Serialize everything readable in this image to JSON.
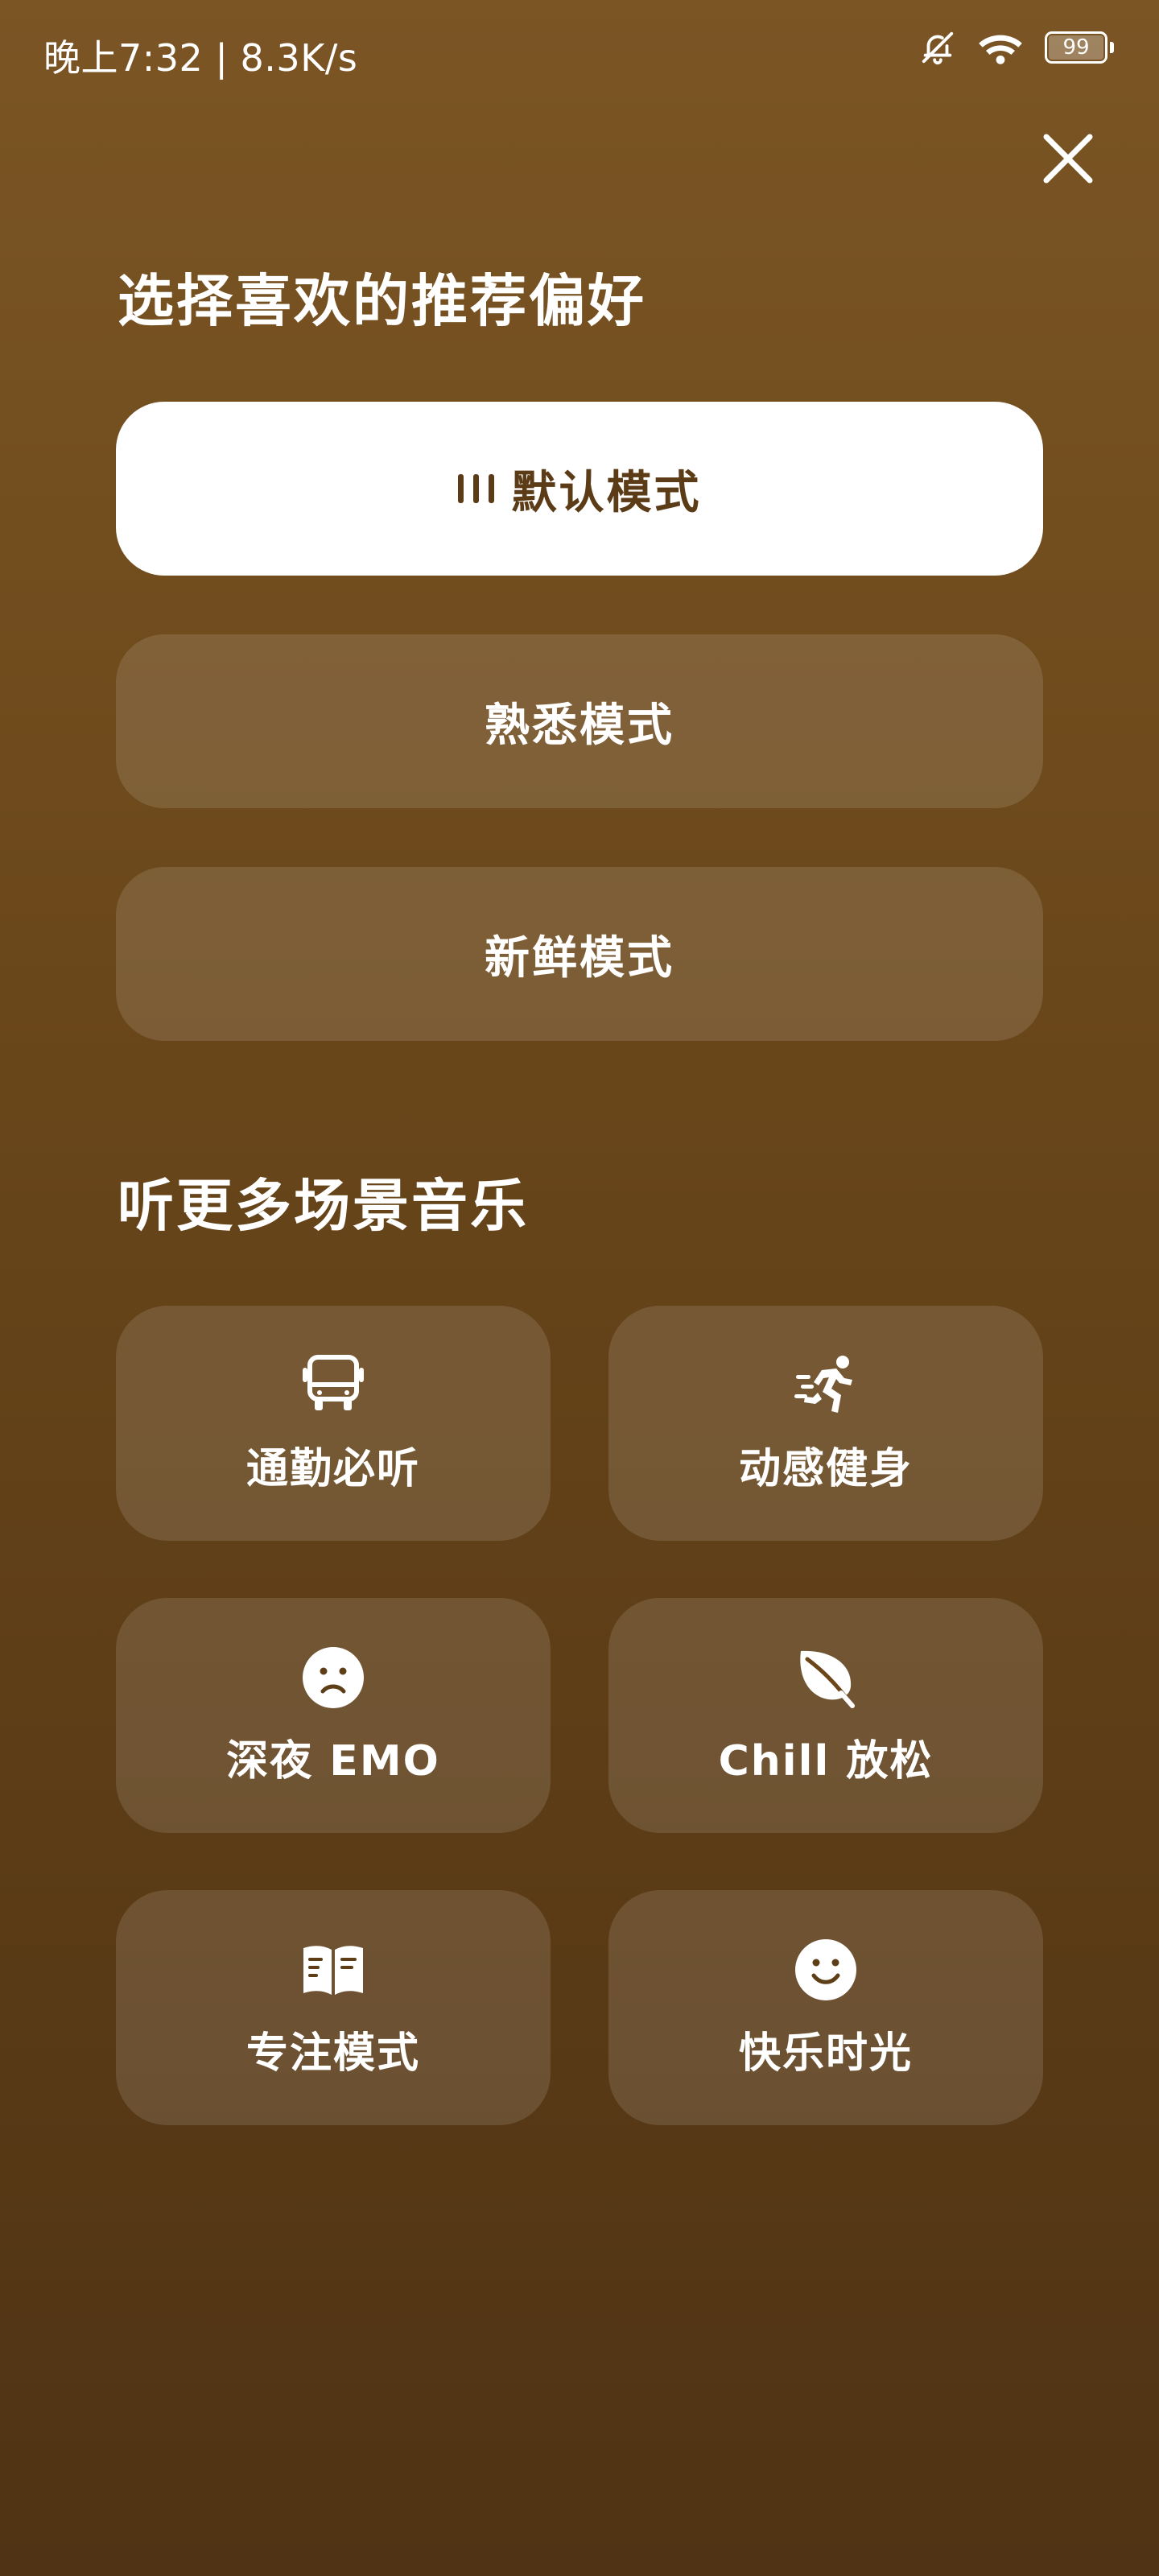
{
  "status_bar": {
    "time": "晚上7:32 | 8.3K/s",
    "battery": "99",
    "icons": [
      "bell-off-icon",
      "wifi-icon",
      "battery-icon"
    ]
  },
  "close_icon": "close-icon",
  "preference": {
    "title": "选择喜欢的推荐偏好",
    "modes": [
      {
        "label": "默认模式",
        "selected": true,
        "icon": "bars-icon"
      },
      {
        "label": "熟悉模式",
        "selected": false
      },
      {
        "label": "新鲜模式",
        "selected": false
      }
    ]
  },
  "scenes": {
    "title": "听更多场景音乐",
    "items": [
      {
        "label": "通勤必听",
        "icon": "bus-icon"
      },
      {
        "label": "动感健身",
        "icon": "running-icon"
      },
      {
        "label": "深夜 EMO",
        "icon": "sad-face-icon"
      },
      {
        "label": "Chill 放松",
        "icon": "leaf-icon"
      },
      {
        "label": "专注模式",
        "icon": "book-icon"
      },
      {
        "label": "快乐时光",
        "icon": "happy-face-icon"
      }
    ]
  },
  "colors": {
    "background_top": "#7b5524",
    "background_bottom": "#4f3314",
    "selected_text": "#5b3c17"
  }
}
